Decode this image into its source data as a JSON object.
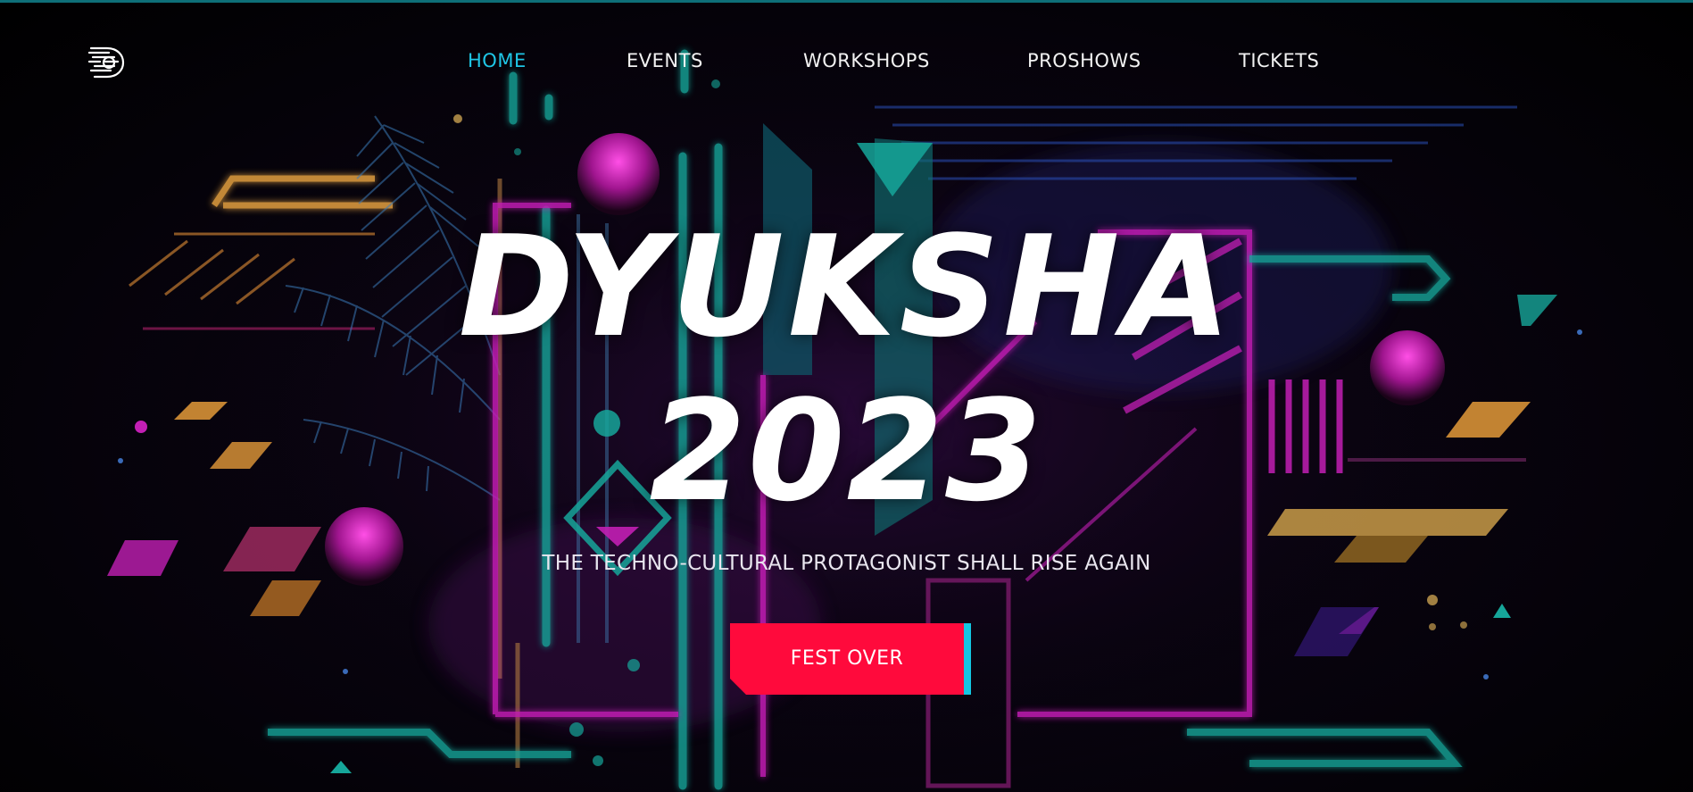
{
  "nav": {
    "items": [
      {
        "label": "HOME",
        "active": true
      },
      {
        "label": "EVENTS",
        "active": false
      },
      {
        "label": "WORKSHOPS",
        "active": false
      },
      {
        "label": "PROSHOWS",
        "active": false
      },
      {
        "label": "TICKETS",
        "active": false
      }
    ],
    "logo_icon": "dyuksha-logo-icon"
  },
  "hero": {
    "title_line1": "DYUKSHA",
    "title_line2": "2023",
    "tagline": "THE TECHNO-CULTURAL PROTAGONIST SHALL RISE AGAIN"
  },
  "cta": {
    "label": "FEST OVER"
  },
  "colors": {
    "accent_cyan": "#1fc6e6",
    "cta_red": "#ff0a3c",
    "neon_magenta": "#c21fb4",
    "neon_teal": "#16a69a",
    "neon_orange": "#f0a040"
  }
}
